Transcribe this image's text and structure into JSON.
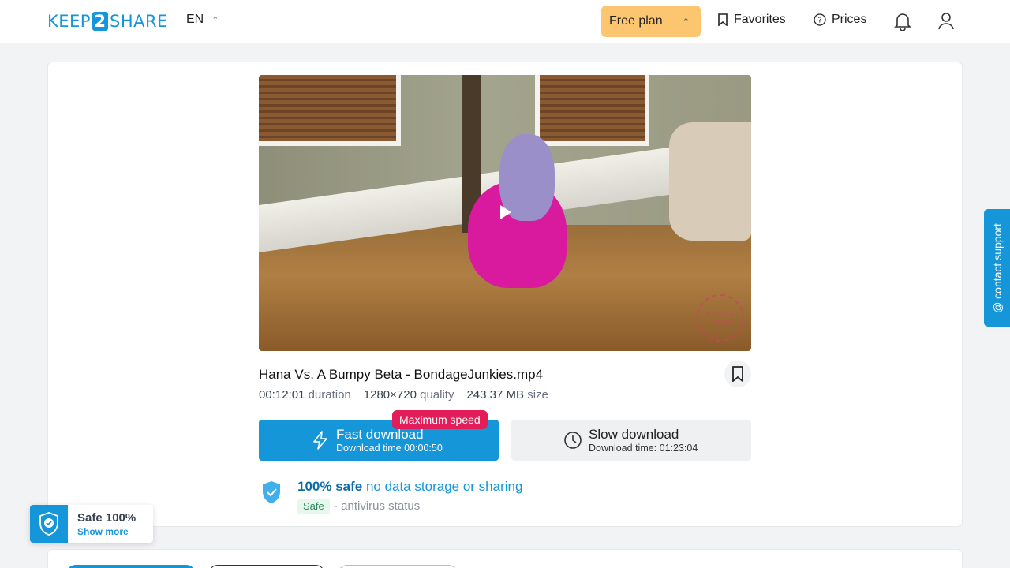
{
  "header": {
    "logo_left": "KEEP",
    "logo_num": "2",
    "logo_right": "SHARE",
    "language": "EN",
    "plan_label": "Free plan",
    "favorites_label": "Favorites",
    "prices_label": "Prices"
  },
  "file": {
    "name": "Hana Vs. A Bumpy Beta - BondageJunkies.mp4",
    "duration_value": "00:12:01",
    "duration_label": "duration",
    "quality_value": "1280×720",
    "quality_label": "quality",
    "size_value": "243.37 MB",
    "size_label": "size"
  },
  "download": {
    "fast_label": "Fast download",
    "fast_time": "Download time 00:00:50",
    "badge": "Maximum speed",
    "slow_label": "Slow download",
    "slow_time": "Download time: 01:23:04"
  },
  "safety": {
    "headline_bold": "100% safe",
    "headline_rest": " no data storage or sharing",
    "tag": "Safe",
    "status": "- antivirus status"
  },
  "support": {
    "label": "@ contact support"
  },
  "widget": {
    "title": "Safe 100%",
    "link": "Show more"
  },
  "video_watermark": "BONDAGE JUNKIES",
  "colors": {
    "brand": "#1596d8",
    "plan": "#fbc66f",
    "badge": "#e21d5a"
  }
}
